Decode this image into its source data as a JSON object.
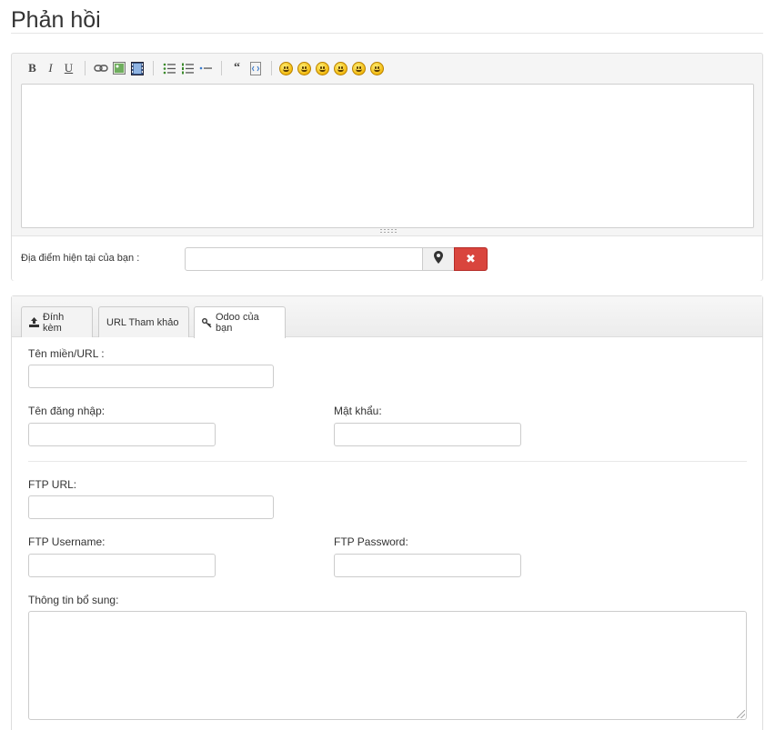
{
  "page": {
    "title": "Phản hồi"
  },
  "editor": {
    "toolbar": {
      "bold": "B",
      "italic": "I",
      "underline": "U",
      "quote": "“"
    },
    "smileys": [
      "laugh",
      "grin",
      "surprised",
      "shock",
      "smile",
      "wink"
    ]
  },
  "location": {
    "label": "Địa điểm hiện tại của bạn :",
    "value": "",
    "clear_symbol": "✖"
  },
  "tabs": [
    {
      "label": "Đính kèm",
      "icon": "upload-icon"
    },
    {
      "label": "URL Tham khảo",
      "icon": ""
    },
    {
      "label": "Odoo của bạn",
      "icon": "key-icon",
      "active": true
    }
  ],
  "form": {
    "domain_label": "Tên miền/URL :",
    "username_label": "Tên đăng nhập:",
    "password_label": "Mật khẩu:",
    "ftp_url_label": "FTP URL:",
    "ftp_username_label": "FTP Username:",
    "ftp_password_label": "FTP Password:",
    "extra_info_label": "Thông tin bổ sung:"
  },
  "colors": {
    "accent_danger": "#d9453d",
    "panel_bg": "#f5f5f5",
    "border": "#dddddd"
  }
}
